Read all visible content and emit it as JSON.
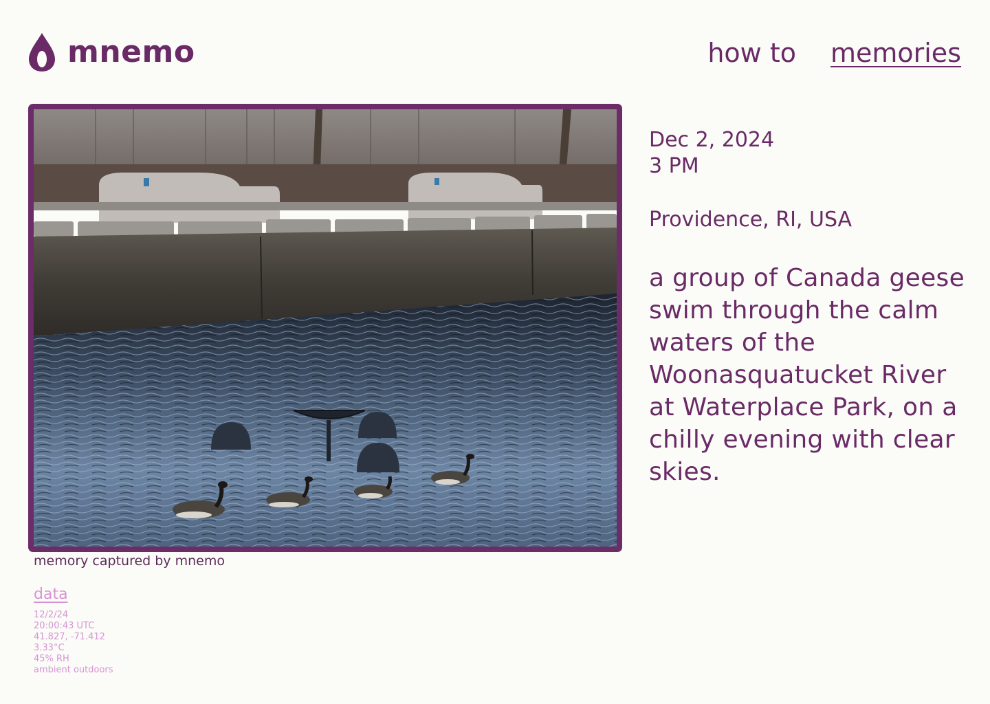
{
  "header": {
    "logo_text": "mnemo",
    "nav": [
      {
        "label": "how to",
        "active": false
      },
      {
        "label": "memories",
        "active": true
      }
    ]
  },
  "memory": {
    "photo_alt": "Canada geese swimming on a river beside a stone wall with benches",
    "caption": "memory captured by mnemo",
    "date": "Dec 2, 2024",
    "time": "3 PM",
    "location": "Providence, RI, USA",
    "description": "a group of Canada geese swim through the calm waters of the Woonasquatucket River at Waterplace Park, on a chilly evening with clear skies."
  },
  "data_section": {
    "link_label": "data",
    "items": [
      "12/2/24",
      "20:00:43 UTC",
      "41.827, -71.412",
      "3.33°C",
      "45% RH",
      "ambient outdoors"
    ]
  },
  "colors": {
    "brand": "#6a2a66",
    "frame": "#6b2c68",
    "data_text": "#d793d3",
    "background": "#fbfcf8"
  },
  "icons": {
    "logo": "droplet-icon"
  }
}
